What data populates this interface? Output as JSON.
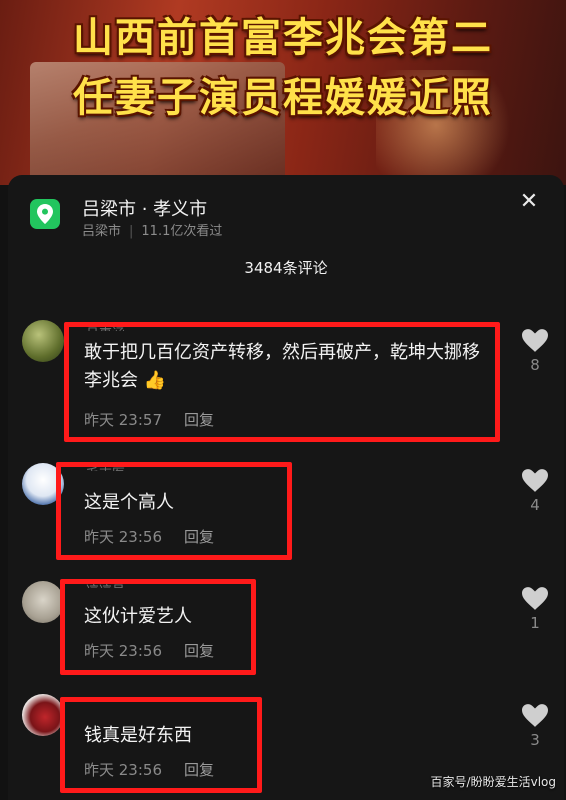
{
  "headline": {
    "line1": "山西前首富李兆会第二",
    "line2": "任妻子演员程媛媛近照"
  },
  "location": {
    "title": "吕梁市 · 孝义市",
    "city": "吕梁市",
    "views": "11.1亿次看过"
  },
  "comment_count": "3484条评论",
  "comments": [
    {
      "text": "敢于把几百亿资产转移，然后再破产，乾坤大挪移李兆会",
      "time": "昨天 23:57",
      "reply": "回复",
      "likes": "8",
      "emoji": "thumbs-up"
    },
    {
      "text": "这是个高人",
      "time": "昨天 23:56",
      "reply": "回复",
      "likes": "4"
    },
    {
      "text": "这伙计爱艺人",
      "time": "昨天 23:56",
      "reply": "回复",
      "likes": "1"
    },
    {
      "text": "钱真是好东西",
      "time": "昨天 23:56",
      "reply": "回复",
      "likes": "3"
    }
  ],
  "watermark": "百家号/盼盼爱生活vlog",
  "colors": {
    "highlight": "#ff1a1a",
    "headline": "#ffe14a",
    "location_icon": "#22c55e"
  }
}
